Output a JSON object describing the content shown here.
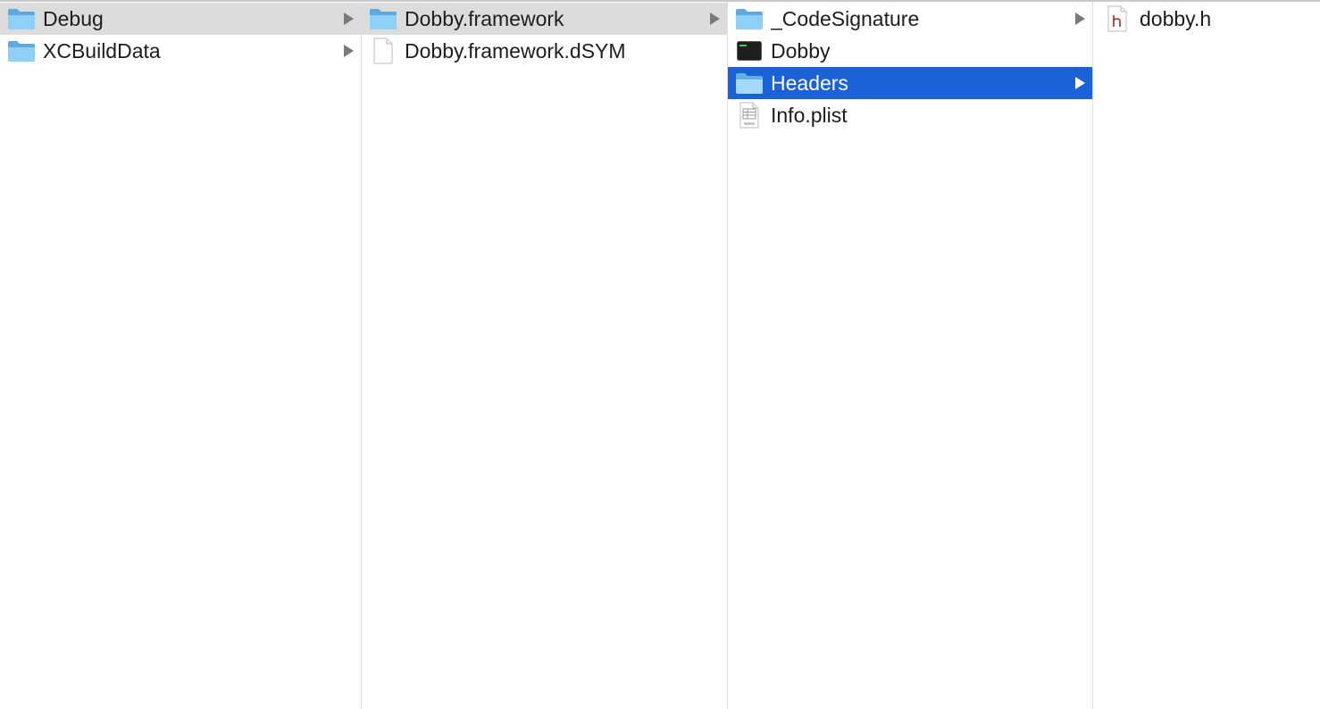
{
  "columns": [
    {
      "items": [
        {
          "label": "Debug",
          "icon": "folder-icon",
          "chevron": true,
          "state": "path-selected"
        },
        {
          "label": "XCBuildData",
          "icon": "folder-icon",
          "chevron": true,
          "state": "normal"
        }
      ]
    },
    {
      "items": [
        {
          "label": "Dobby.framework",
          "icon": "folder-icon",
          "chevron": true,
          "state": "path-selected"
        },
        {
          "label": "Dobby.framework.dSYM",
          "icon": "document-icon",
          "chevron": false,
          "state": "normal"
        }
      ]
    },
    {
      "items": [
        {
          "label": "_CodeSignature",
          "icon": "folder-icon",
          "chevron": true,
          "state": "normal"
        },
        {
          "label": "Dobby",
          "icon": "exec-icon",
          "chevron": false,
          "state": "normal"
        },
        {
          "label": "Headers",
          "icon": "folder-icon",
          "chevron": true,
          "state": "active-selected"
        },
        {
          "label": "Info.plist",
          "icon": "plist-icon",
          "chevron": false,
          "state": "normal"
        }
      ]
    },
    {
      "items": [
        {
          "label": "dobby.h",
          "icon": "header-file-icon",
          "chevron": false,
          "state": "normal"
        }
      ]
    }
  ],
  "colors": {
    "selection_active": "#1b62d8",
    "selection_path": "#dcdcdc",
    "folder_blue": "#7cc4f6"
  }
}
